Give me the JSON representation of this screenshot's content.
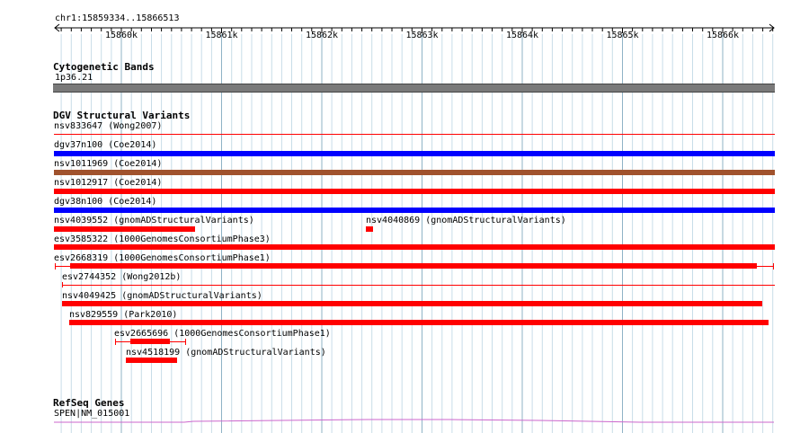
{
  "location": "chr1:15859334..15866513",
  "scale": {
    "labels": [
      "15860k",
      "15861k",
      "15862k",
      "15863k",
      "15864k",
      "15865k",
      "15866k"
    ]
  },
  "cytobands": {
    "title": "Cytogenetic Bands",
    "band": "1p36.21",
    "color": "#7a7a7a"
  },
  "dgv": {
    "title": "DGV Structural Variants",
    "colors": {
      "loss": "#ff0000",
      "gain": "#0000ff",
      "complex": "#a0522d"
    },
    "features": [
      {
        "label": "nsv833647 (Wong2007)",
        "type": "loss",
        "style": "thin"
      },
      {
        "label": "dgv37n100 (Coe2014)",
        "type": "gain",
        "style": "full"
      },
      {
        "label": "nsv1011969 (Coe2014)",
        "type": "complex",
        "style": "full"
      },
      {
        "label": "nsv1012917 (Coe2014)",
        "type": "loss",
        "style": "full"
      },
      {
        "label": "dgv38n100 (Coe2014)",
        "type": "gain",
        "style": "full"
      },
      {
        "label": "nsv4039552 (gnomADStructuralVariants)",
        "type": "loss",
        "style": "full"
      },
      {
        "label": "nsv4040869 (gnomADStructuralVariants)",
        "type": "loss",
        "style": "full"
      },
      {
        "label": "esv3585322 (1000GenomesConsortiumPhase3)",
        "type": "loss",
        "style": "full"
      },
      {
        "label": "esv2668319 (1000GenomesConsortiumPhase1)",
        "type": "loss",
        "style": "bracket"
      },
      {
        "label": "esv2744352 (Wong2012b)",
        "type": "loss",
        "style": "thin"
      },
      {
        "label": "nsv4049425 (gnomADStructuralVariants)",
        "type": "loss",
        "style": "full"
      },
      {
        "label": "nsv829559 (Park2010)",
        "type": "loss",
        "style": "full"
      },
      {
        "label": "esv2665696 (1000GenomesConsortiumPhase1)",
        "type": "loss",
        "style": "bracket"
      },
      {
        "label": "nsv4518199 (gnomADStructuralVariants)",
        "type": "loss",
        "style": "full"
      }
    ]
  },
  "refseq": {
    "title": "RefSeq Genes",
    "gene": "SPEN|NM_015001",
    "color": "#cc66cc"
  }
}
